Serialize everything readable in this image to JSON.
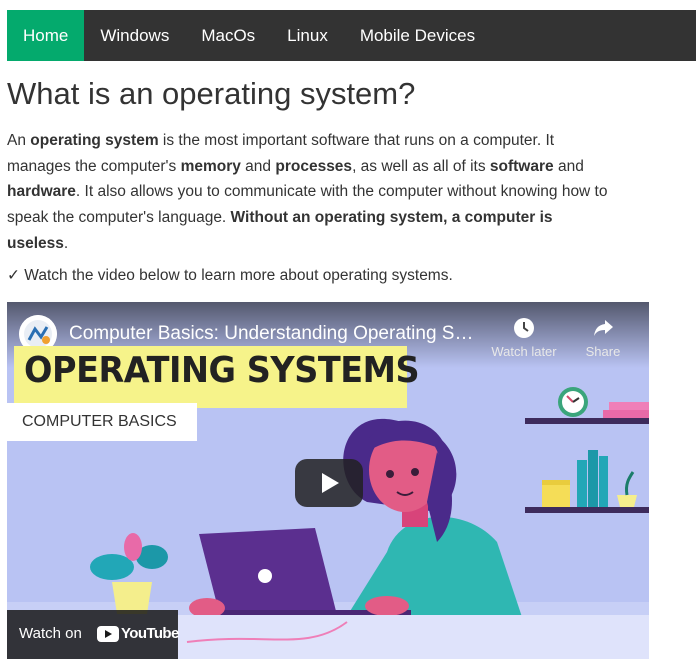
{
  "nav": {
    "items": [
      {
        "label": "Home",
        "active": true
      },
      {
        "label": "Windows",
        "active": false
      },
      {
        "label": "MacOs",
        "active": false
      },
      {
        "label": "Linux",
        "active": false
      },
      {
        "label": "Mobile Devices",
        "active": false
      }
    ],
    "bg_color": "#333333",
    "active_color": "#04AA6D"
  },
  "main": {
    "title": "What is an operating system?",
    "intro": {
      "t1": "An ",
      "b1": "operating system",
      "t2": " is the most important software that runs on a computer. It manages the computer's ",
      "b2": "memory",
      "t3": " and ",
      "b3": "processes",
      "t4": ", as well as all of its ",
      "b4": "software",
      "t5": " and ",
      "b5": "hardware",
      "t6": ". It also allows you to communicate with the computer without knowing how to speak the computer's language. ",
      "b6": "Without an operating system, a computer is useless",
      "t7": "."
    },
    "note": "✓ Watch the video below to learn more about operating systems."
  },
  "video": {
    "title": "Computer Basics: Understanding Operating Syste...",
    "watch_later_label": "Watch later",
    "share_label": "Share",
    "banner_title": "OPERATING SYSTEMS",
    "banner_subtitle": "COMPUTER BASICS",
    "watch_on_label": "Watch on",
    "youtube_logo_text": "YouTube",
    "icons": [
      "clock-icon",
      "share-arrow-icon",
      "play-icon",
      "youtube-logo-icon"
    ]
  }
}
